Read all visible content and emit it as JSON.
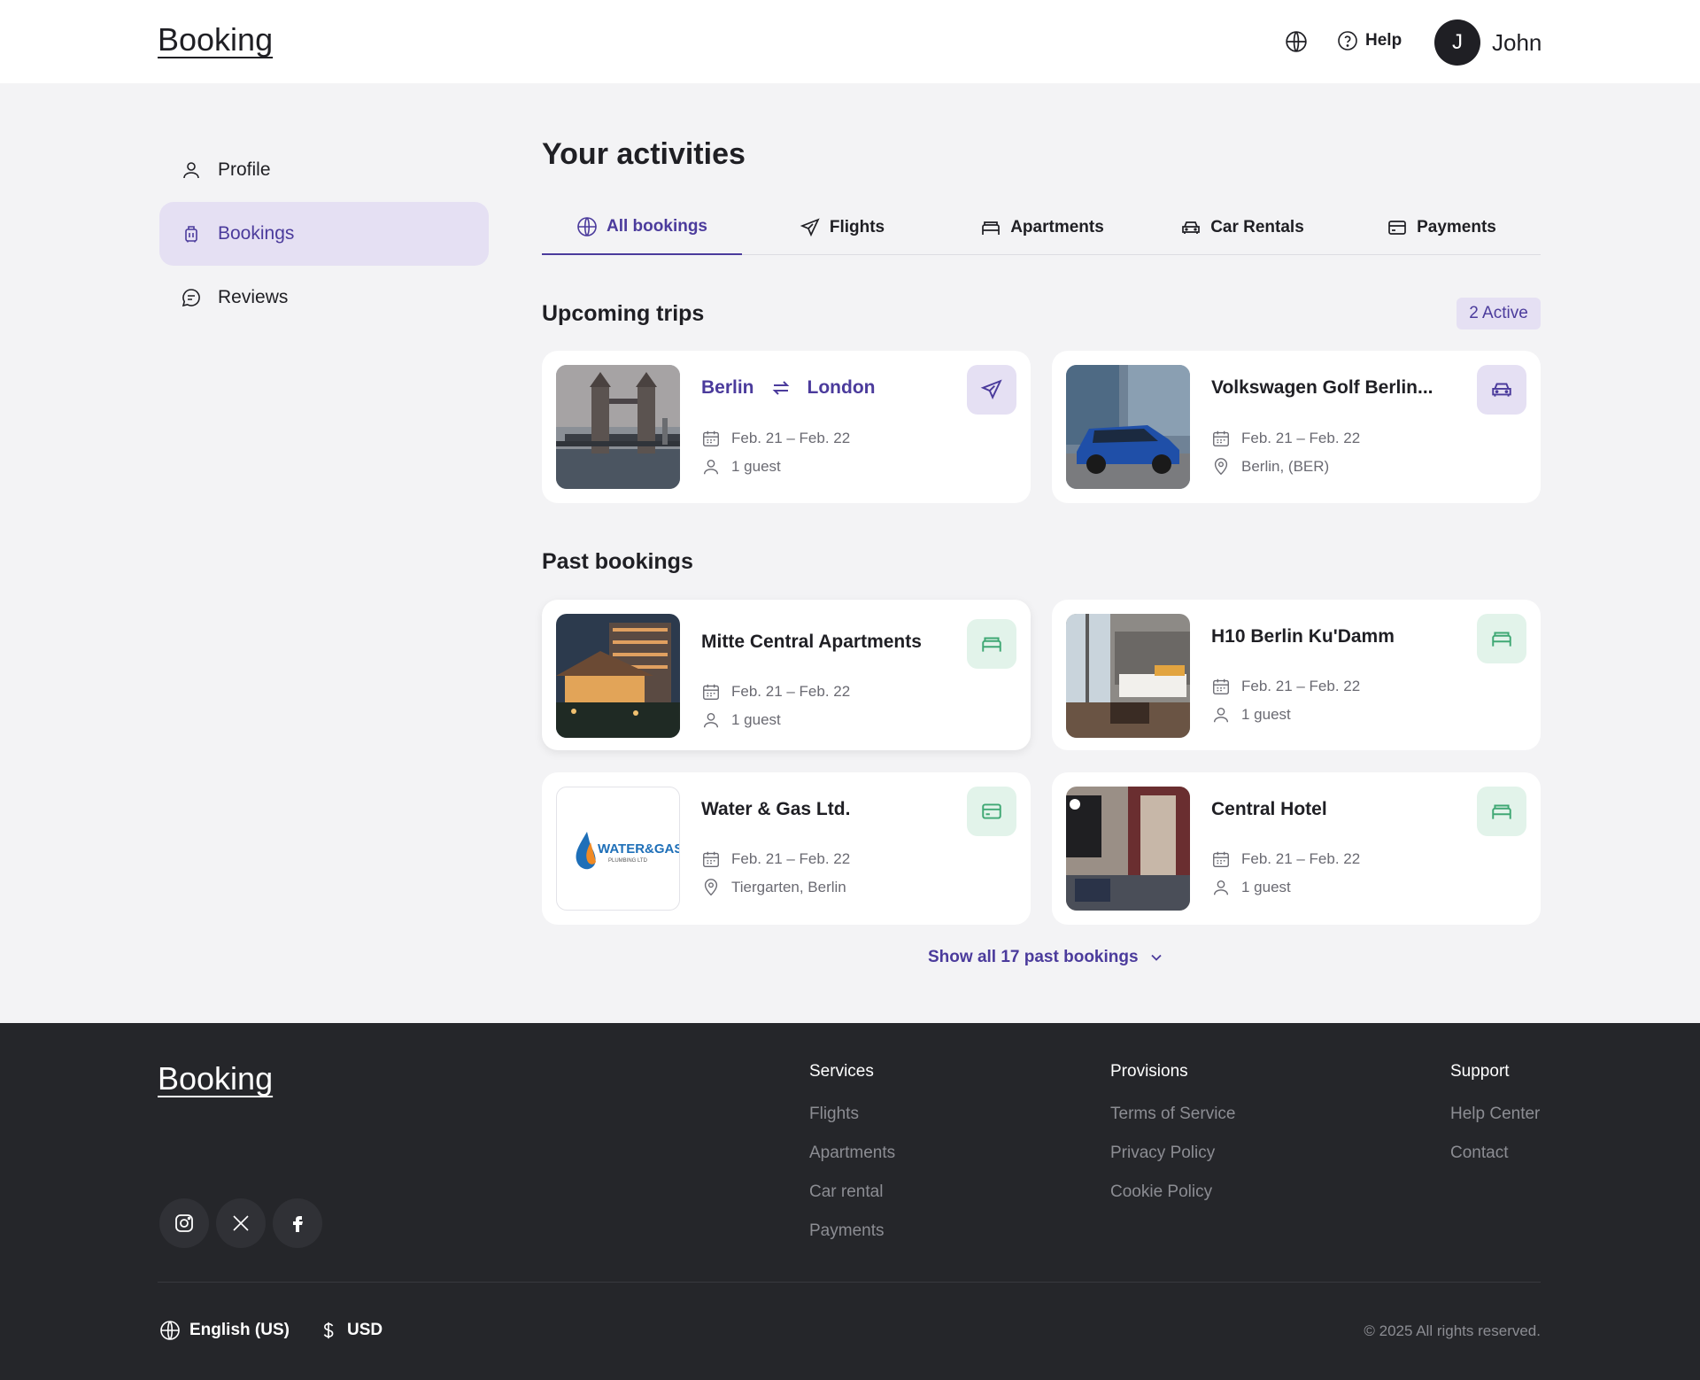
{
  "header": {
    "logo": "Booking",
    "help_label": "Help",
    "avatar_initial": "J",
    "user_name": "John"
  },
  "sidebar": {
    "items": [
      {
        "label": "Profile",
        "icon": "user-icon"
      },
      {
        "label": "Bookings",
        "icon": "luggage-icon",
        "active": true
      },
      {
        "label": "Reviews",
        "icon": "chat-icon"
      }
    ]
  },
  "main": {
    "title": "Your activities",
    "tabs": [
      {
        "label": "All bookings",
        "icon": "globe-icon",
        "active": true
      },
      {
        "label": "Flights",
        "icon": "plane-icon"
      },
      {
        "label": "Apartments",
        "icon": "bed-icon"
      },
      {
        "label": "Car Rentals",
        "icon": "car-icon"
      },
      {
        "label": "Payments",
        "icon": "card-icon"
      }
    ],
    "upcoming": {
      "title": "Upcoming trips",
      "badge": "2 Active",
      "cards": [
        {
          "from": "Berlin",
          "to": "London",
          "dates": "Feb. 21 – Feb. 22",
          "detail": "1 guest",
          "type": "flight"
        },
        {
          "title": "Volkswagen Golf Berlin...",
          "dates": "Feb. 21 – Feb. 22",
          "detail": "Berlin, (BER)",
          "type": "car"
        }
      ]
    },
    "past": {
      "title": "Past bookings",
      "cards": [
        {
          "title": "Mitte Central Apartments",
          "dates": "Feb. 21 – Feb. 22",
          "detail": "1 guest",
          "type": "apartment"
        },
        {
          "title": "H10 Berlin Ku'Damm",
          "dates": "Feb. 21 – Feb. 22",
          "detail": "1 guest",
          "type": "apartment"
        },
        {
          "title": "Water & Gas Ltd.",
          "dates": "Feb. 21 – Feb. 22",
          "detail": "Tiergarten, Berlin",
          "type": "payment",
          "logo_text": "WATER&GAS",
          "logo_sub": "PLUMBING LTD"
        },
        {
          "title": "Central Hotel",
          "dates": "Feb. 21 – Feb. 22",
          "detail": "1 guest",
          "type": "apartment"
        }
      ]
    },
    "show_all": "Show all 17 past bookings"
  },
  "footer": {
    "logo": "Booking",
    "columns": [
      {
        "title": "Services",
        "links": [
          "Flights",
          "Apartments",
          "Car rental",
          "Payments"
        ]
      },
      {
        "title": "Provisions",
        "links": [
          "Terms of Service",
          "Privacy Policy",
          "Cookie Policy"
        ]
      },
      {
        "title": "Support",
        "links": [
          "Help Center",
          "Contact"
        ]
      }
    ],
    "language": "English (US)",
    "currency": "USD",
    "copyright": "© 2025 All rights reserved."
  },
  "colors": {
    "accent": "#4b3b9c",
    "accent_bg": "#e5e0f3",
    "green": "#3fa874",
    "green_bg": "#e2f3ea",
    "footer_bg": "#25262a"
  }
}
